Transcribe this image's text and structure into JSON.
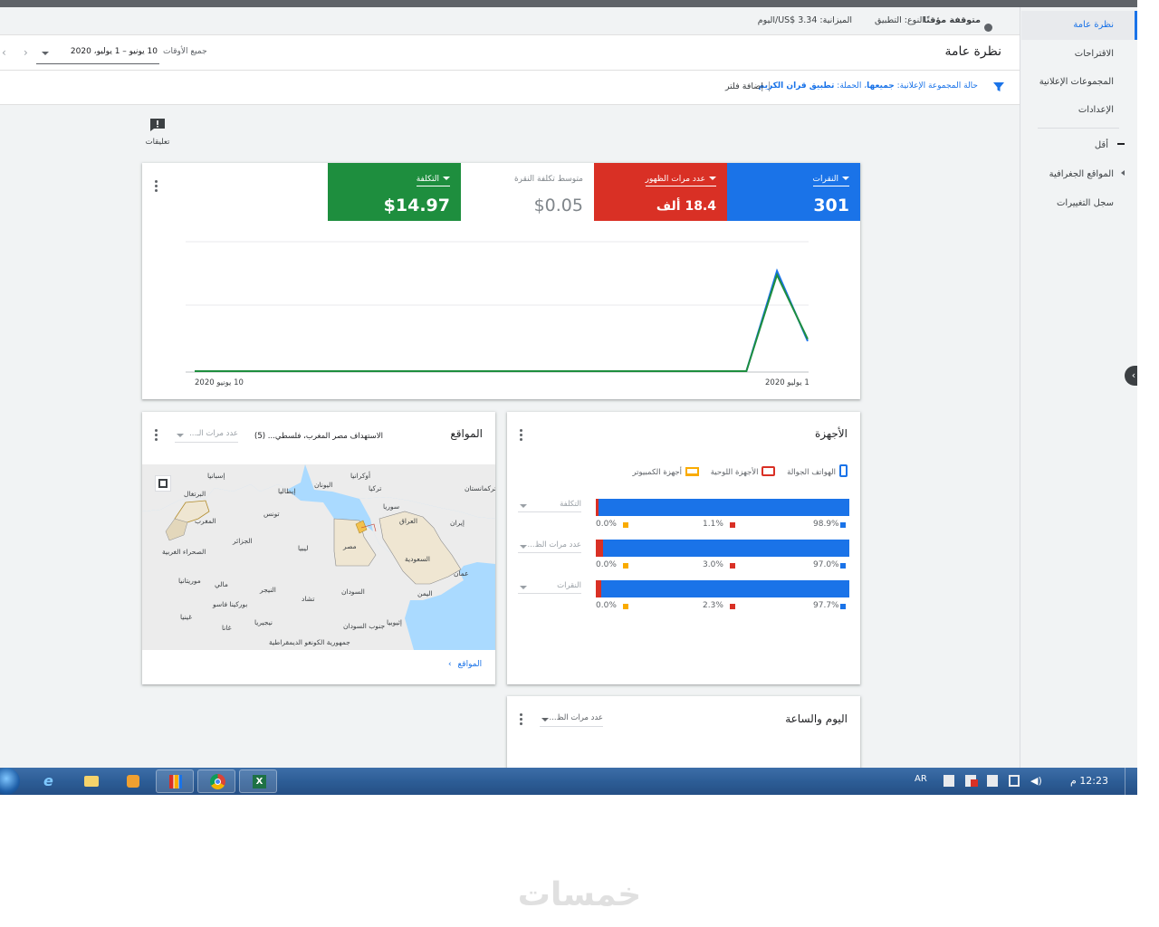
{
  "status": {
    "state": "متوقفة مؤقتًا",
    "type": "النوع: التطبيق",
    "budget": "الميزانية: US$ 3.34/اليوم"
  },
  "header": {
    "title": "نظرة عامة",
    "all_time_label": "جميع الأوقات",
    "date_range": "10 يونيو – 1 يوليو، 2020"
  },
  "filter": {
    "text_prefix": "حالة المجموعة الإعلانية:",
    "text_status": "جميعها",
    "text_campaign_label": "الحملة:",
    "text_campaign": "تطبيق قران الكريم",
    "add_filter": "إضافة فلتر"
  },
  "sidebar": {
    "items": [
      {
        "label": "نظرة عامة"
      },
      {
        "label": "الاقتراحات"
      },
      {
        "label": "المجموعات الإعلانية"
      },
      {
        "label": "الإعدادات"
      },
      {
        "label": "أقل"
      },
      {
        "label": "المواقع الجغرافية"
      },
      {
        "label": "سجل التغييرات"
      }
    ]
  },
  "feedback": {
    "label": "تعليقات"
  },
  "metrics": [
    {
      "label": "النقرات",
      "value": "301",
      "color": "#1a73e8"
    },
    {
      "label": "عدد مرات الظهور",
      "value": "18.4 ألف",
      "color": "#d93025"
    },
    {
      "label": "متوسط تكلفة النقرة",
      "value": "$0.05",
      "color": "#ffffff"
    },
    {
      "label": "التكلفة",
      "value": "$14.97",
      "color": "#1e8e3e"
    }
  ],
  "chart_data": {
    "type": "line",
    "x_start_label": "10 يونيو 2020",
    "x_end_label": "1 يوليو 2020",
    "series": [
      {
        "color": "#1a73e8",
        "values": [
          0,
          0,
          0,
          0,
          0,
          0,
          0,
          0,
          0,
          0,
          0,
          0,
          0,
          0,
          0,
          0,
          0,
          0,
          0,
          1,
          0.3
        ]
      },
      {
        "color": "#1e8e3e",
        "values": [
          0,
          0,
          0,
          0,
          0,
          0,
          0,
          0,
          0,
          0,
          0,
          0,
          0,
          0,
          0,
          0,
          0,
          0,
          0,
          0.96,
          0.32
        ]
      }
    ],
    "ylim": [
      0,
      1.3
    ]
  },
  "locations": {
    "title": "المواقع",
    "metric_select": "عدد مرات الـ...",
    "targeting": "الاستهداف مصر المغرب، فلسطي...",
    "targeting_count": "(5)",
    "link": "المواقع",
    "map_labels": [
      "أوكرانيا",
      "إسبانيا",
      "البرتغال",
      "إيطاليا",
      "اليونان",
      "تركيا",
      "تركمانستان",
      "سوريا",
      "العراق",
      "إيران",
      "تونس",
      "الجزائر",
      "ليبيا",
      "مصر",
      "المغرب",
      "الصحراء الغربية",
      "السعودية",
      "عمان",
      "اليمن",
      "موريتانيا",
      "مالي",
      "النيجر",
      "تشاد",
      "السودان",
      "بوركينا فاسو",
      "غينيا",
      "غانا",
      "نيجيريا",
      "جنوب السودان",
      "إثيوبيا",
      "جمهورية الكونغو الديمقراطية"
    ]
  },
  "devices": {
    "title": "الأجهزة",
    "legend": [
      {
        "label": "الهواتف الجوالة",
        "color": "#1a73e8"
      },
      {
        "label": "الأجهزة اللوحية",
        "color": "#d93025"
      },
      {
        "label": "أجهزة الكمبيوتر",
        "color": "#f9ab00"
      }
    ],
    "rows": [
      {
        "metric": "التكلفة",
        "mobile": 98.9,
        "tablet": 1.1,
        "desktop": 0.0,
        "mobile_label": "98.9%",
        "tablet_label": "1.1%",
        "desktop_label": "0.0%"
      },
      {
        "metric": "عدد مرات الظ...",
        "mobile": 97.0,
        "tablet": 3.0,
        "desktop": 0.0,
        "mobile_label": "97.0%",
        "tablet_label": "3.0%",
        "desktop_label": "0.0%"
      },
      {
        "metric": "النقرات",
        "mobile": 97.7,
        "tablet": 2.3,
        "desktop": 0.0,
        "mobile_label": "97.7%",
        "tablet_label": "2.3%",
        "desktop_label": "0.0%"
      }
    ]
  },
  "dayhour": {
    "title": "اليوم والساعة",
    "metric_select": "عدد مرات الظ..."
  },
  "taskbar": {
    "lang": "AR",
    "time": "12:23 م"
  },
  "watermark": "خمسات"
}
